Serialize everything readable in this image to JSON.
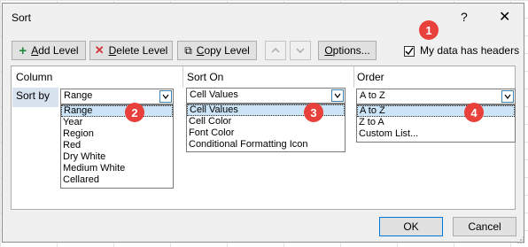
{
  "dialog": {
    "title": "Sort",
    "help": "?",
    "close": "✕"
  },
  "toolbar": {
    "add_level": "Add Level",
    "add_level_ul": "A",
    "delete_level": "Delete Level",
    "delete_level_ul": "D",
    "copy_level": "Copy Level",
    "copy_level_ul": "C",
    "options": "Options...",
    "options_ul": "O",
    "headers_label": "My data has headers",
    "headers_checked": true
  },
  "columns": {
    "column": "Column",
    "sort_on": "Sort On",
    "order": "Order"
  },
  "row": {
    "label": "Sort by",
    "column_value": "Range",
    "sort_on_value": "Cell Values",
    "order_value": "A to Z"
  },
  "column_options": [
    "Range",
    "Year",
    "Region",
    "Red",
    "Dry White",
    "Medium White",
    "Cellared"
  ],
  "sort_on_options": [
    "Cell Values",
    "Cell Color",
    "Font Color",
    "Conditional Formatting Icon"
  ],
  "order_options": [
    "A to Z",
    "Z to A",
    "Custom List..."
  ],
  "badges": [
    "1",
    "2",
    "3",
    "4"
  ],
  "buttons": {
    "ok": "OK",
    "cancel": "Cancel"
  },
  "colors": {
    "badge": "#e8403a",
    "selected": "#cce4f7",
    "accent": "#0078d7"
  }
}
